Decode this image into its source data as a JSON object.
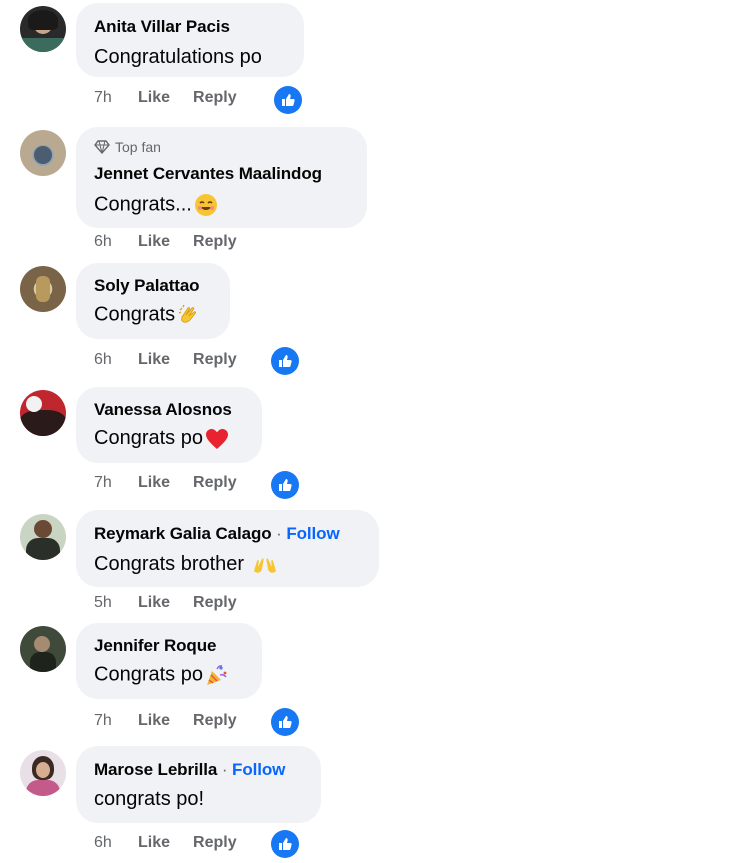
{
  "comments": [
    {
      "name": "Anita Villar Pacis",
      "text": "Congratulations po",
      "time": "7h",
      "like": "Like",
      "reply": "Reply",
      "reaction": "like-icon"
    },
    {
      "badge": "Top fan",
      "name": "Jennet Cervantes Maalindog",
      "text": "Congrats...",
      "time": "6h",
      "like": "Like",
      "reply": "Reply",
      "emoji": "smiling-face-emoji"
    },
    {
      "name": "Soly Palattao",
      "text": "Congrats",
      "time": "6h",
      "like": "Like",
      "reply": "Reply",
      "reaction": "like-icon",
      "emoji": "clapping-hands-emoji"
    },
    {
      "name": "Vanessa Alosnos",
      "text": "Congrats po",
      "time": "7h",
      "like": "Like",
      "reply": "Reply",
      "reaction": "like-icon",
      "emoji": "red-heart-emoji"
    },
    {
      "name": "Reymark Galia Calago",
      "follow_sep": "·",
      "follow": "Follow",
      "text": "Congrats brother",
      "time": "5h",
      "like": "Like",
      "reply": "Reply",
      "emoji": "raising-hands-emoji"
    },
    {
      "name": "Jennifer Roque",
      "text": "Congrats po",
      "time": "7h",
      "like": "Like",
      "reply": "Reply",
      "reaction": "like-icon",
      "emoji": "party-popper-emoji"
    },
    {
      "name": "Marose Lebrilla",
      "follow_sep": "·",
      "follow": "Follow",
      "text": "congrats po!",
      "time": "6h",
      "like": "Like",
      "reply": "Reply",
      "reaction": "like-icon"
    }
  ],
  "colors": {
    "bubble": "#f0f2f5",
    "secondary_text": "#65676b",
    "follow": "#0866ff",
    "like_reaction": "#1877f2"
  }
}
